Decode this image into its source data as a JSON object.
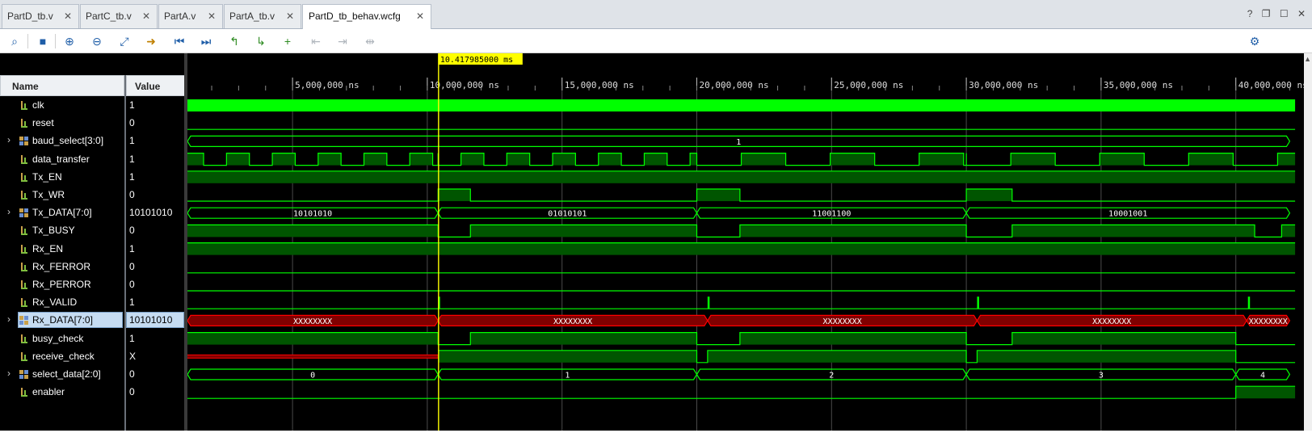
{
  "tabs": [
    {
      "label": "PartD_tb.v",
      "active": false
    },
    {
      "label": "PartC_tb.v",
      "active": false
    },
    {
      "label": "PartA.v",
      "active": false
    },
    {
      "label": "PartA_tb.v",
      "active": false
    },
    {
      "label": "PartD_tb_behav.wcfg",
      "active": true
    }
  ],
  "window_buttons": [
    "?",
    "restore",
    "maximize",
    "close"
  ],
  "toolbar": {
    "icons": [
      "search-icon",
      "save-icon",
      "zoom-in-icon",
      "zoom-out-icon",
      "zoom-fit-icon",
      "go-to-cursor-icon",
      "go-to-start-icon",
      "go-to-end-icon",
      "previous-transition-icon",
      "next-transition-icon",
      "add-marker-icon",
      "previous-marker-icon",
      "next-marker-icon",
      "swap-cursors-icon",
      "settings-gear-icon"
    ]
  },
  "cursor": {
    "time_label": "10.417985000 ms",
    "time_ns": 10417985
  },
  "columns": {
    "name": "Name",
    "value": "Value"
  },
  "timeline": {
    "unit": "ns",
    "ticks": [
      {
        "t": 5000000,
        "label": "5,000,000 ns"
      },
      {
        "t": 10000000,
        "label": "10,000,000 ns"
      },
      {
        "t": 15000000,
        "label": "15,000,000 ns"
      },
      {
        "t": 20000000,
        "label": "20,000,000 ns"
      },
      {
        "t": 25000000,
        "label": "25,000,000 ns"
      },
      {
        "t": 30000000,
        "label": "30,000,000 ns"
      },
      {
        "t": 35000000,
        "label": "35,000,000 ns"
      },
      {
        "t": 40000000,
        "label": "40,000,000 ns"
      }
    ]
  },
  "signals": [
    {
      "name": "clk",
      "value": "1",
      "kind": "bit",
      "expandable": false
    },
    {
      "name": "reset",
      "value": "0",
      "kind": "bit",
      "expandable": false
    },
    {
      "name": "baud_select[3:0]",
      "value": "1",
      "kind": "bus",
      "expandable": true
    },
    {
      "name": "data_transfer",
      "value": "1",
      "kind": "bit",
      "expandable": false
    },
    {
      "name": "Tx_EN",
      "value": "1",
      "kind": "bit",
      "expandable": false
    },
    {
      "name": "Tx_WR",
      "value": "0",
      "kind": "bit",
      "expandable": false
    },
    {
      "name": "Tx_DATA[7:0]",
      "value": "10101010",
      "kind": "bus",
      "expandable": true
    },
    {
      "name": "Tx_BUSY",
      "value": "0",
      "kind": "bit",
      "expandable": false
    },
    {
      "name": "Rx_EN",
      "value": "1",
      "kind": "bit",
      "expandable": false
    },
    {
      "name": "Rx_FERROR",
      "value": "0",
      "kind": "bit",
      "expandable": false
    },
    {
      "name": "Rx_PERROR",
      "value": "0",
      "kind": "bit",
      "expandable": false
    },
    {
      "name": "Rx_VALID",
      "value": "1",
      "kind": "bit",
      "expandable": false
    },
    {
      "name": "Rx_DATA[7:0]",
      "value": "10101010",
      "kind": "bus",
      "expandable": true,
      "selected": true
    },
    {
      "name": "busy_check",
      "value": "1",
      "kind": "bit",
      "expandable": false
    },
    {
      "name": "receive_check",
      "value": "X",
      "kind": "bit",
      "expandable": false
    },
    {
      "name": "select_data[2:0]",
      "value": "0",
      "kind": "bus",
      "expandable": true
    },
    {
      "name": "enabler",
      "value": "0",
      "kind": "bit",
      "expandable": false
    }
  ],
  "bus_segments": {
    "baud_select": [
      {
        "from": 0,
        "to": 42000000,
        "label": "1"
      }
    ],
    "tx_data": [
      {
        "from": 0,
        "to": 10400000,
        "label": "10101010"
      },
      {
        "from": 10400000,
        "to": 20000000,
        "label": "01010101"
      },
      {
        "from": 20000000,
        "to": 30000000,
        "label": "11001100"
      },
      {
        "from": 30000000,
        "to": 42000000,
        "label": "10001001"
      }
    ],
    "rx_data": [
      {
        "from": 0,
        "to": 10400000,
        "label": "XXXXXXXX"
      },
      {
        "from": 10400000,
        "to": 20400000,
        "label": "XXXXXXXX"
      },
      {
        "from": 20400000,
        "to": 30400000,
        "label": "XXXXXXXX"
      },
      {
        "from": 30400000,
        "to": 40400000,
        "label": "XXXXXXXX"
      },
      {
        "from": 40400000,
        "to": 42000000,
        "label": "XXXXXXXX"
      }
    ],
    "select_data": [
      {
        "from": 0,
        "to": 10400000,
        "label": "0"
      },
      {
        "from": 10400000,
        "to": 20000000,
        "label": "1"
      },
      {
        "from": 20000000,
        "to": 30000000,
        "label": "2"
      },
      {
        "from": 30000000,
        "to": 40000000,
        "label": "3"
      },
      {
        "from": 40000000,
        "to": 42000000,
        "label": "4"
      }
    ]
  },
  "colors": {
    "wave": "#00ff00",
    "wave_fill": "#005500",
    "bus_x": "#ff0000",
    "bus_x_fill": "#800000",
    "cursor": "#ffff00",
    "grid": "#4a4a4a"
  }
}
